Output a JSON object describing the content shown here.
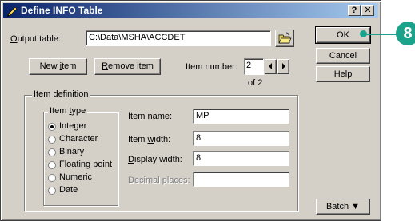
{
  "window": {
    "title": "Define INFO Table",
    "help_btn": "?",
    "close_btn": "✕"
  },
  "output": {
    "label_u": "O",
    "label_rest": "utput table:",
    "value": "C:\\Data\\MSHA\\ACCDET"
  },
  "buttons": {
    "new_item_pre": "New ",
    "new_item_u": "i",
    "new_item_post": "tem",
    "remove_u": "R",
    "remove_rest": "emove item",
    "ok": "OK",
    "cancel": "Cancel",
    "help": "Help",
    "batch": "Batch ▼"
  },
  "item_number": {
    "label": "Item number:",
    "value": "2",
    "of": "of 2"
  },
  "item_definition": {
    "title": "Item definition"
  },
  "item_type": {
    "legend_pre": "Item ",
    "legend_u": "t",
    "legend_post": "ype",
    "options": [
      "Integer",
      "Character",
      "Binary",
      "Floating point",
      "Numeric",
      "Date"
    ],
    "selected": "Integer"
  },
  "fields": {
    "name_pre": "Item ",
    "name_u": "n",
    "name_post": "ame:",
    "name_value": "MP",
    "width_pre": "Item ",
    "width_u": "w",
    "width_post": "idth:",
    "width_value": "8",
    "display_u": "D",
    "display_post": "isplay width:",
    "display_value": "8",
    "decimal_label": "Decimal places:",
    "decimal_value": ""
  },
  "callout": {
    "number": "8",
    "color": "#1aa38a"
  }
}
